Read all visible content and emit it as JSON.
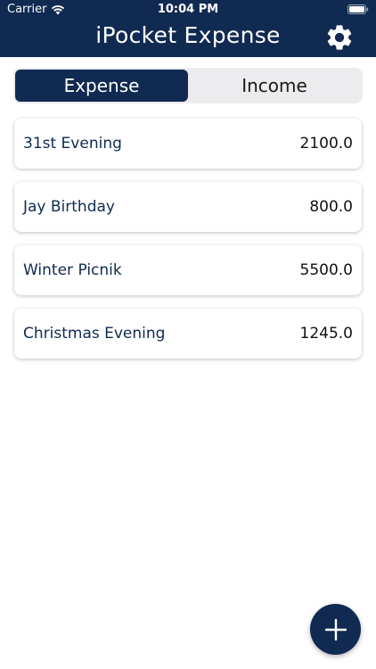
{
  "status_bar": {
    "carrier": "Carrier",
    "time": "10:04 PM"
  },
  "header": {
    "title": "iPocket Expense",
    "settings_icon": "gear-icon",
    "background_color": "#102a51"
  },
  "tabs": [
    {
      "label": "Expense",
      "selected": true
    },
    {
      "label": "Income",
      "selected": false
    }
  ],
  "entries": [
    {
      "name": "31st Evening",
      "amount": "2100.0"
    },
    {
      "name": "Jay Birthday",
      "amount": "800.0"
    },
    {
      "name": "Winter Picnik",
      "amount": "5500.0"
    },
    {
      "name": "Christmas Evening",
      "amount": "1245.0"
    }
  ],
  "fab": {
    "icon": "plus-icon"
  }
}
